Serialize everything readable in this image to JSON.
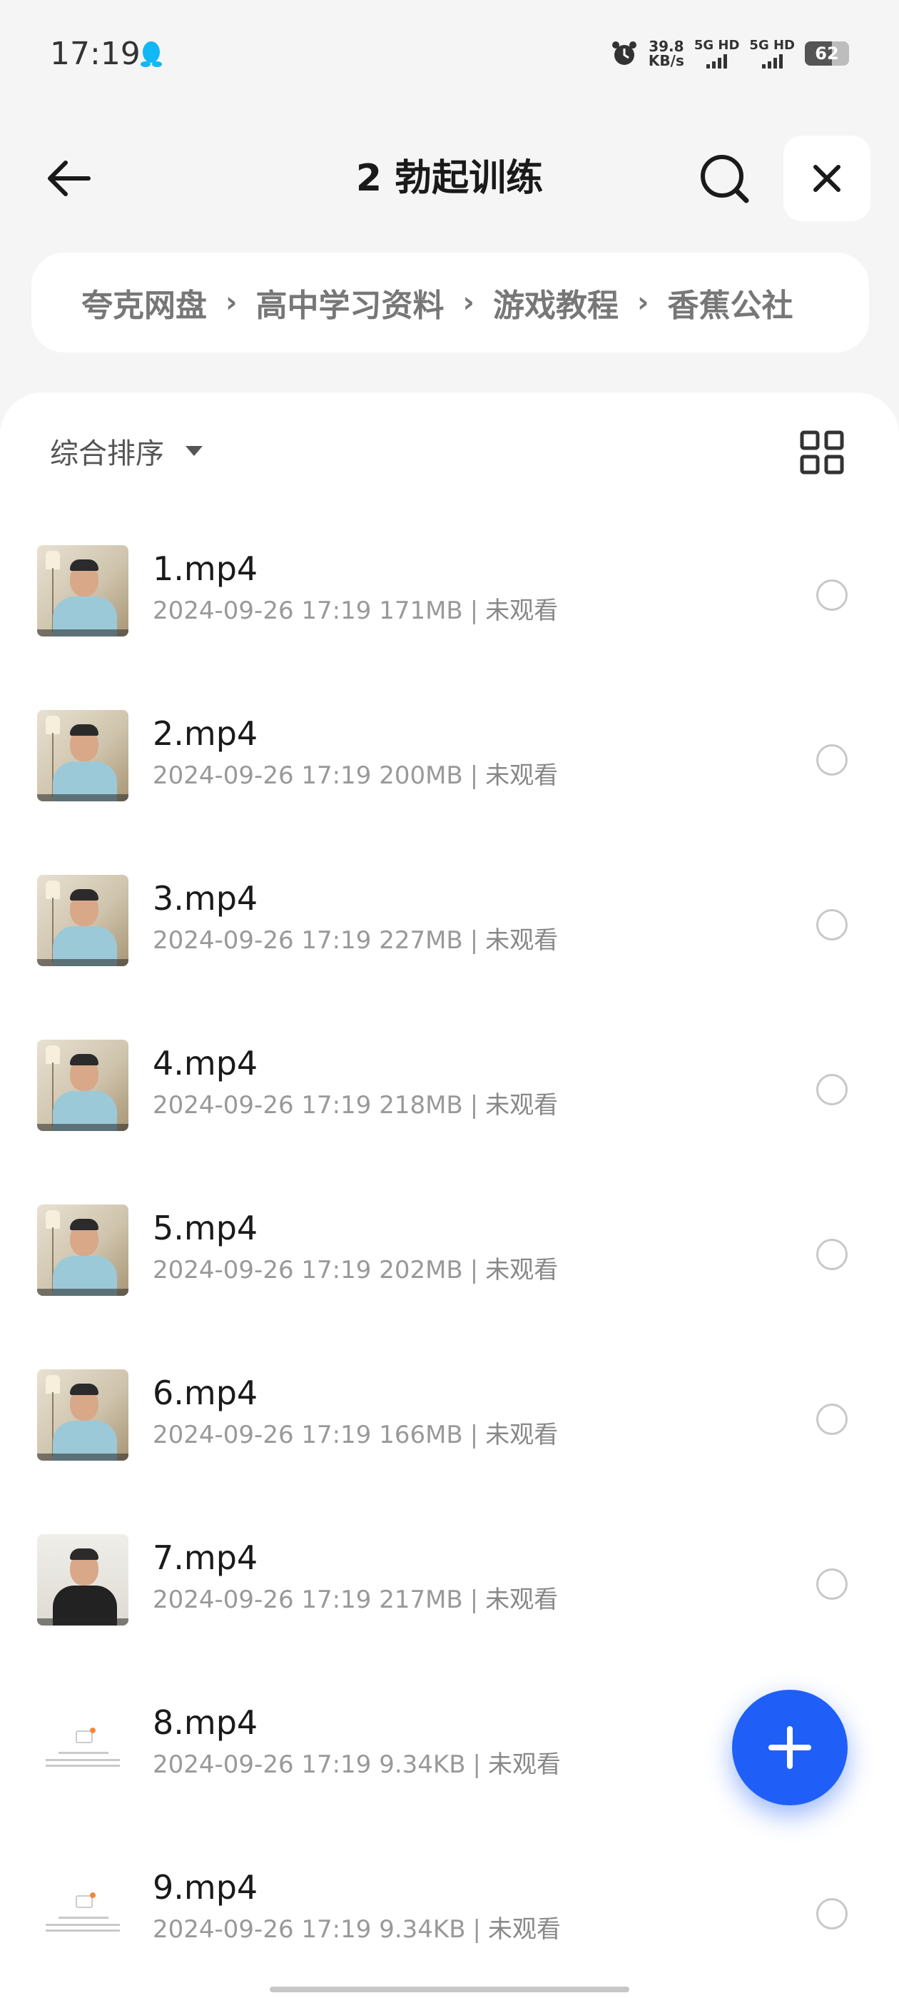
{
  "status_bar": {
    "time": "17:19",
    "net_speed_value": "39.8",
    "net_speed_unit": "KB/s",
    "signal1_label": "5G HD",
    "signal2_label": "5G HD",
    "battery_level": "62"
  },
  "header": {
    "title": "2 勃起训练",
    "back_icon": "arrow-left-icon",
    "search_icon": "search-icon",
    "close_icon": "close-icon"
  },
  "breadcrumb": {
    "items": [
      "夸克网盘",
      "高中学习资料",
      "游戏教程",
      "香蕉公社"
    ],
    "separator": "›"
  },
  "toolbar": {
    "sort_label": "综合排序",
    "view_toggle_icon": "grid-view-icon"
  },
  "files": [
    {
      "name": "1.mp4",
      "date": "2024-09-26 17:19",
      "size": "171MB",
      "status": "未观看",
      "thumb": "video"
    },
    {
      "name": "2.mp4",
      "date": "2024-09-26 17:19",
      "size": "200MB",
      "status": "未观看",
      "thumb": "video"
    },
    {
      "name": "3.mp4",
      "date": "2024-09-26 17:19",
      "size": "227MB",
      "status": "未观看",
      "thumb": "video"
    },
    {
      "name": "4.mp4",
      "date": "2024-09-26 17:19",
      "size": "218MB",
      "status": "未观看",
      "thumb": "video"
    },
    {
      "name": "5.mp4",
      "date": "2024-09-26 17:19",
      "size": "202MB",
      "status": "未观看",
      "thumb": "video"
    },
    {
      "name": "6.mp4",
      "date": "2024-09-26 17:19",
      "size": "166MB",
      "status": "未观看",
      "thumb": "video"
    },
    {
      "name": "7.mp4",
      "date": "2024-09-26 17:19",
      "size": "217MB",
      "status": "未观看",
      "thumb": "video-dark"
    },
    {
      "name": "8.mp4",
      "date": "2024-09-26 17:19",
      "size": "9.34KB",
      "status": "未观看",
      "thumb": "doc"
    },
    {
      "name": "9.mp4",
      "date": "2024-09-26 17:19",
      "size": "9.34KB",
      "status": "未观看",
      "thumb": "doc"
    }
  ],
  "fab": {
    "icon": "plus-icon"
  },
  "colors": {
    "accent": "#1f5ff7",
    "background": "#f5f5f5"
  }
}
